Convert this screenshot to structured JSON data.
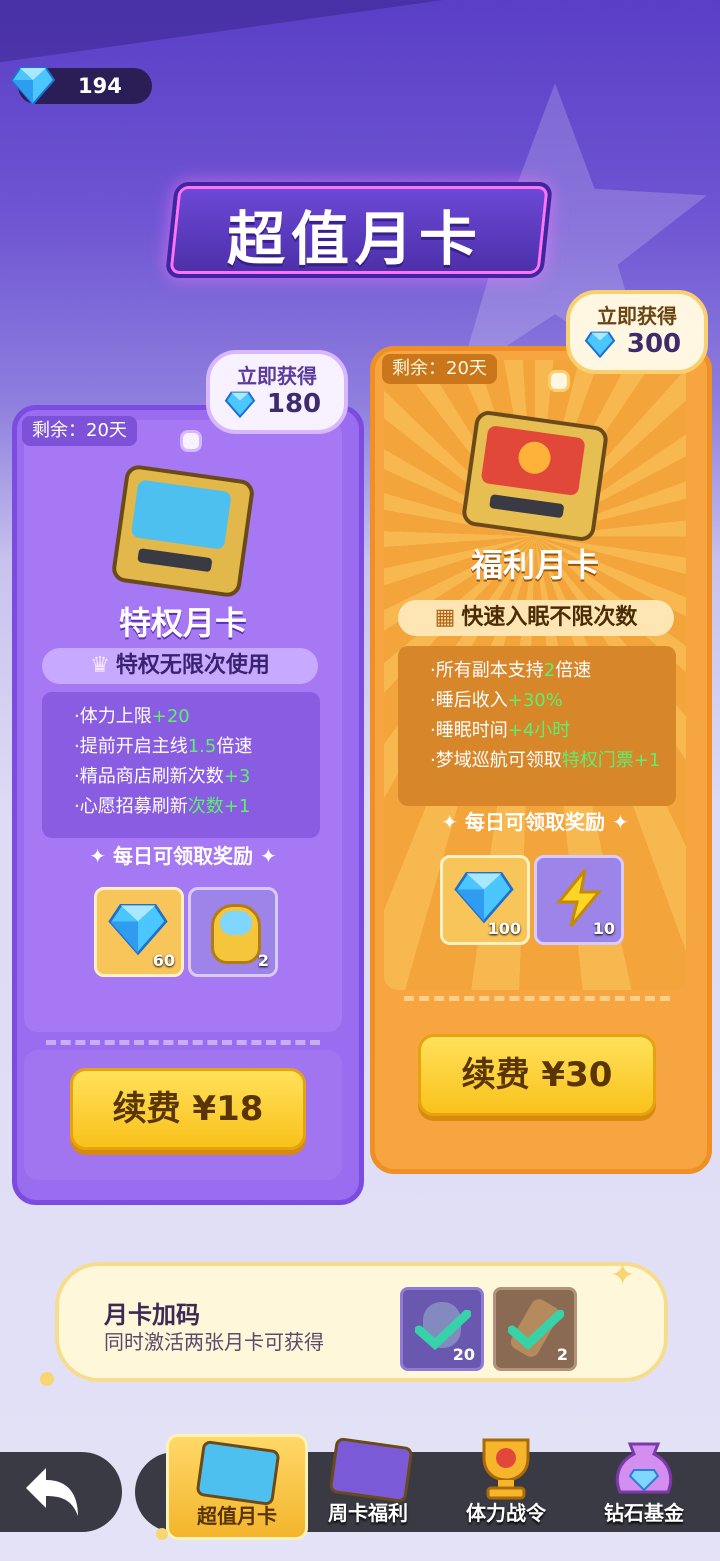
{
  "currency": {
    "icon": "diamond-icon",
    "amount": "194"
  },
  "title": "超值月卡",
  "cards": [
    {
      "id": "privilege",
      "remaining": "剩余：20天",
      "instant_label": "立即获得",
      "instant_amount": "180",
      "name": "特权月卡",
      "feature_title": "特权无限次使用",
      "features": [
        {
          "text": "体力上限",
          "highlight": "+20"
        },
        {
          "text": "提前开启主线",
          "highlight": "1.5",
          "suffix": "倍速"
        },
        {
          "text": "精品商店刷新次数",
          "highlight": "+3"
        },
        {
          "text": "心愿招募刷新",
          "highlight": "次数+1"
        }
      ],
      "daily_label": "每日可领取奖励",
      "rewards": [
        {
          "icon": "diamond-icon",
          "count": "60"
        },
        {
          "icon": "pet-egg-icon",
          "count": "2"
        }
      ],
      "button_label": "续费 ¥18"
    },
    {
      "id": "welfare",
      "remaining": "剩余：20天",
      "instant_label": "立即获得",
      "instant_amount": "300",
      "name": "福利月卡",
      "feature_title": "快速入眠不限次数",
      "features": [
        {
          "text": "所有副本支持",
          "highlight": "2",
          "suffix": "倍速"
        },
        {
          "text": "睡后收入",
          "highlight": "+30%"
        },
        {
          "text": "睡眠时间",
          "highlight": "+4小时"
        },
        {
          "text": "梦域巡航可领取",
          "highlight": "特权门票+1"
        }
      ],
      "daily_label": "每日可领取奖励",
      "rewards": [
        {
          "icon": "diamond-icon",
          "count": "100"
        },
        {
          "icon": "lightning-icon",
          "count": "10"
        }
      ],
      "button_label": "续费 ¥30"
    }
  ],
  "bonus": {
    "title": "月卡加码",
    "subtitle": "同时激活两张月卡可获得",
    "rewards": [
      {
        "icon": "pet-egg-icon",
        "count": "20"
      },
      {
        "icon": "key-icon",
        "count": "2"
      }
    ]
  },
  "nav": {
    "back_icon": "back-arrow-icon",
    "tabs": [
      {
        "label": "超值月卡",
        "active": true
      },
      {
        "label": "周卡福利"
      },
      {
        "label": "体力战令"
      },
      {
        "label": "钻石基金"
      }
    ]
  },
  "colors": {
    "purple_card": "#9a6df0",
    "orange_card": "#f6a541",
    "highlight_green": "#5df070",
    "button_yellow": "#f9c21c"
  }
}
